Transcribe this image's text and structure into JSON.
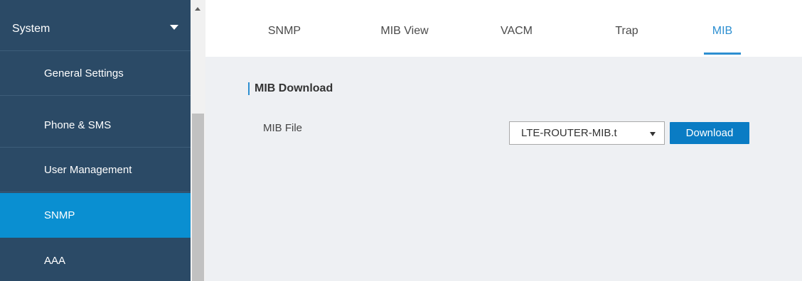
{
  "sidebar": {
    "header": "System",
    "items": [
      {
        "label": "General Settings"
      },
      {
        "label": "Phone & SMS"
      },
      {
        "label": "User Management"
      },
      {
        "label": "SNMP",
        "active": true
      },
      {
        "label": "AAA"
      }
    ]
  },
  "tabs": [
    {
      "label": "SNMP"
    },
    {
      "label": "MIB View"
    },
    {
      "label": "VACM"
    },
    {
      "label": "Trap"
    },
    {
      "label": "MIB",
      "active": true
    }
  ],
  "section": {
    "title": "MIB Download",
    "field_label": "MIB File",
    "select_value": "LTE-ROUTER-MIB.t",
    "download_label": "Download"
  },
  "colors": {
    "sidebar_bg": "#2b4a66",
    "active_blue": "#0a8fd1",
    "accent": "#2d8fd1",
    "content_bg": "#eef0f3"
  }
}
